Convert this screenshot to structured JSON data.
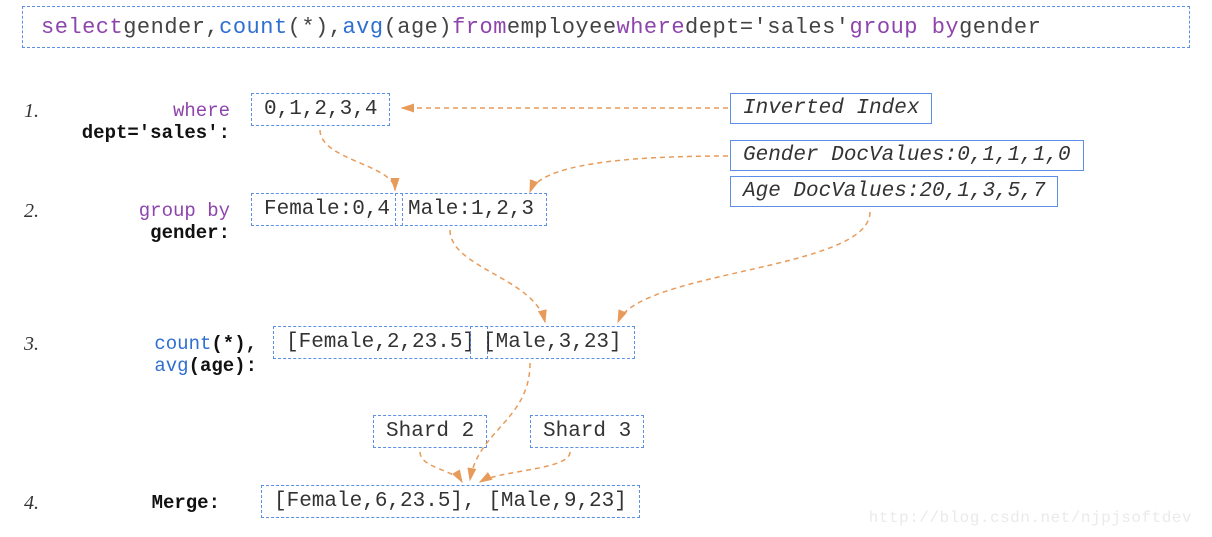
{
  "sql": {
    "select": "select",
    "gender": " gender, ",
    "count": "count",
    "count_arg": "(*), ",
    "avg": "avg",
    "avg_arg": "(age) ",
    "from": "from",
    "table": " employee ",
    "where": "where",
    "where_cond": " dept='sales' ",
    "groupby": "group by",
    "groupby_col": " gender"
  },
  "steps": {
    "s1": {
      "num": "1.",
      "kw": "where",
      "rest": " dept='sales':"
    },
    "s2": {
      "num": "2.",
      "kw": "group by",
      "rest": " gender:"
    },
    "s3": {
      "num": "3.",
      "fn1": "count",
      "fn1_arg": "(*),  ",
      "fn2": "avg",
      "fn2_arg": "(age):"
    },
    "s4": {
      "num": "4.",
      "label": "Merge:"
    }
  },
  "boxes": {
    "ids": "0,1,2,3,4",
    "female_group": "Female:0,4",
    "male_group": "Male:1,2,3",
    "female_agg": "[Female,2,23.5]",
    "male_agg": "[Male,3,23]",
    "shard2": "Shard 2",
    "shard3": "Shard 3",
    "merge": "[Female,6,23.5], [Male,9,23]"
  },
  "side": {
    "inverted": "Inverted Index",
    "gender_dv": "Gender DocValues:0,1,1,1,0",
    "age_dv": "Age DocValues:20,1,3,5,7"
  },
  "watermark": "http://blog.csdn.net/njpjsoftdev"
}
